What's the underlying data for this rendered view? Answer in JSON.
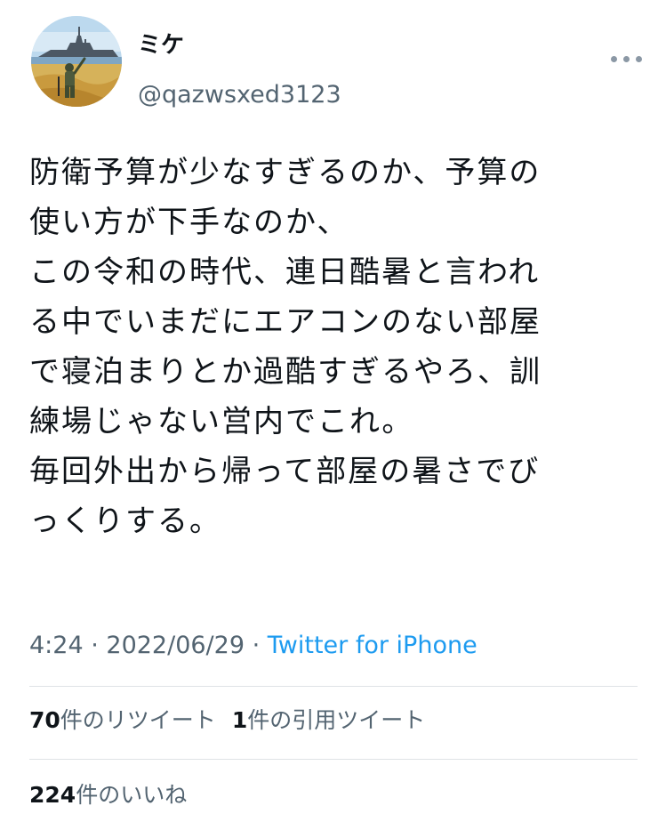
{
  "author": {
    "display_name": "ミケ",
    "handle": "@qazwsxed3123",
    "avatar_icon": "soldier-warship-avatar-icon"
  },
  "tweet": {
    "lines": [
      "防衛予算が少なすぎるのか、予算の",
      "使い方が下手なのか、",
      "この令和の時代、連日酷暑と言われ",
      "る中でいまだにエアコンのない部屋",
      "で寝泊まりとか過酷すぎるやろ、訓",
      "練場じゃない営内でこれ。",
      "毎回外出から帰って部屋の暑さでび",
      "っくりする。"
    ]
  },
  "meta": {
    "time": "4:24",
    "separator": " · ",
    "date": "2022/06/29",
    "source": "Twitter for iPhone"
  },
  "stats": {
    "retweets_count": "70",
    "retweets_label": "件のリツイート",
    "quotes_count": "1",
    "quotes_label": "件の引用ツイート",
    "likes_count": "224",
    "likes_label": "件のいいね"
  },
  "colors": {
    "text": "#0f1419",
    "secondary": "#536471",
    "link": "#1d9bf0",
    "divider": "#dfe3e6"
  }
}
